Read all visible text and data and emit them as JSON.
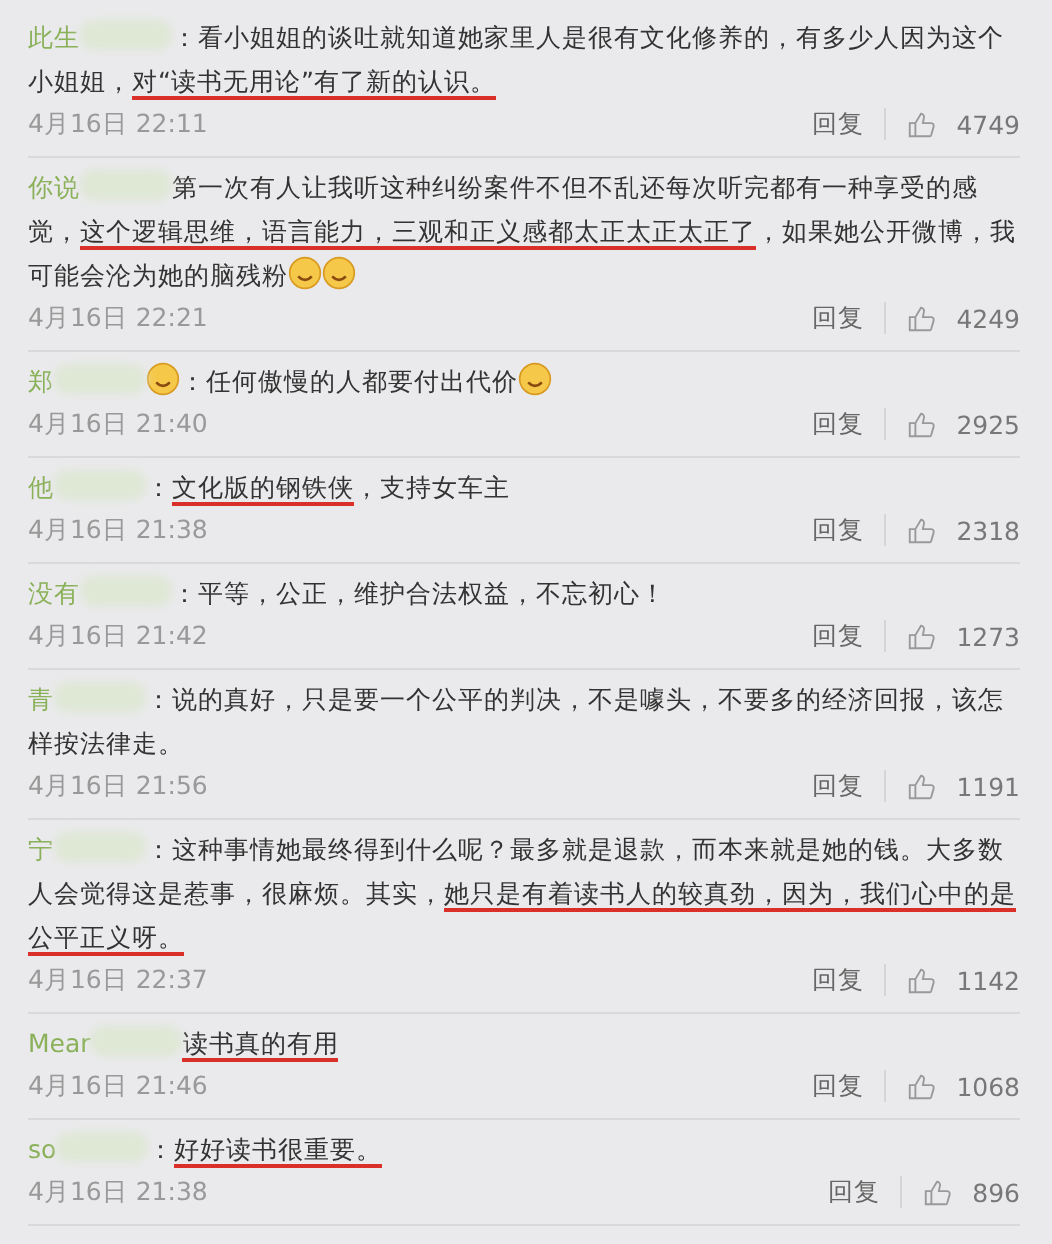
{
  "comments": [
    {
      "user": "此生",
      "segments": [
        {
          "kind": "text",
          "text": "：看小姐姐的谈吐就知道她家里人是很有文化修养的，有多少人因为这个小姐姐，",
          "underlined": false
        },
        {
          "kind": "text",
          "text": "对“读书无用论”有了新的认识。",
          "underlined": true
        }
      ],
      "time": "4月16日 22:11",
      "reply": "回复",
      "likes": "4749"
    },
    {
      "user": "你说",
      "segments": [
        {
          "kind": "text",
          "text": "第一次有人让我听这种纠纷案件不但不乱还每次听完都有一种享受的感觉，",
          "underlined": false
        },
        {
          "kind": "text",
          "text": "这个逻辑思维，语言能力，三观和正义感都太正太正太正了",
          "underlined": true
        },
        {
          "kind": "text",
          "text": "，如果她公开微博，我可能会沦为她的脑残粉",
          "underlined": false
        },
        {
          "kind": "emoji"
        },
        {
          "kind": "emoji"
        }
      ],
      "time": "4月16日 22:21",
      "reply": "回复",
      "likes": "4249"
    },
    {
      "user": "郑",
      "segments": [
        {
          "kind": "emoji"
        },
        {
          "kind": "text",
          "text": "：任何傲慢的人都要付出代价",
          "underlined": false
        },
        {
          "kind": "emoji"
        }
      ],
      "time": "4月16日 21:40",
      "reply": "回复",
      "likes": "2925"
    },
    {
      "user": "他",
      "segments": [
        {
          "kind": "text",
          "text": "：",
          "underlined": false
        },
        {
          "kind": "text",
          "text": "文化版的钢铁侠",
          "underlined": true
        },
        {
          "kind": "text",
          "text": "，支持女车主",
          "underlined": false
        }
      ],
      "time": "4月16日 21:38",
      "reply": "回复",
      "likes": "2318"
    },
    {
      "user": "没有",
      "segments": [
        {
          "kind": "text",
          "text": "：平等，公正，维护合法权益，不忘初心！",
          "underlined": false
        }
      ],
      "time": "4月16日 21:42",
      "reply": "回复",
      "likes": "1273"
    },
    {
      "user": "青",
      "segments": [
        {
          "kind": "text",
          "text": "：说的真好，只是要一个公平的判决，不是噱头，不要多的经济回报，该怎样按法律走。",
          "underlined": false
        }
      ],
      "time": "4月16日 21:56",
      "reply": "回复",
      "likes": "1191"
    },
    {
      "user": "宁",
      "segments": [
        {
          "kind": "text",
          "text": "：这种事情她最终得到什么呢？最多就是退款，而本来就是她的钱。大多数人会觉得这是惹事，很麻烦。其实，",
          "underlined": false
        },
        {
          "kind": "text",
          "text": "她只是有着读书人的较真劲，因为，我们心中的是公平正义呀。",
          "underlined": true
        }
      ],
      "time": "4月16日 22:37",
      "reply": "回复",
      "likes": "1142"
    },
    {
      "user": "Mear",
      "segments": [
        {
          "kind": "text",
          "text": "读书真的有用",
          "underlined": true
        }
      ],
      "time": "4月16日 21:46",
      "reply": "回复",
      "likes": "1068"
    },
    {
      "user": "so",
      "segments": [
        {
          "kind": "text",
          "text": "：",
          "underlined": false
        },
        {
          "kind": "text",
          "text": "好好读书很重要。",
          "underlined": true
        }
      ],
      "time": "4月16日 21:38",
      "reply": "回复",
      "likes": "896"
    }
  ]
}
